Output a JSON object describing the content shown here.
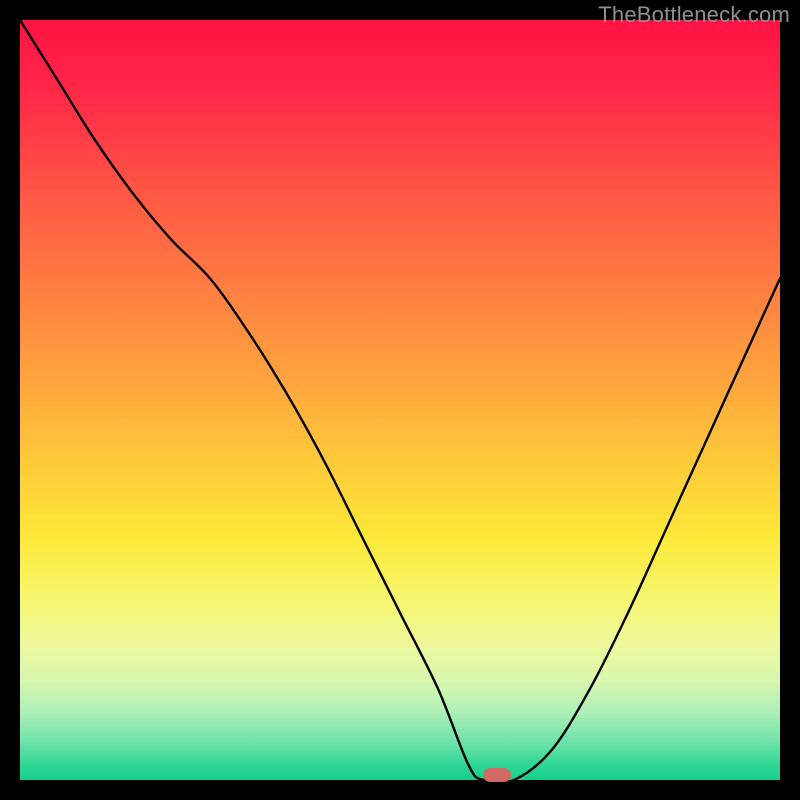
{
  "watermark": "TheBottleneck.com",
  "marker": {
    "x_fraction": 0.628,
    "y_fraction": 0.994
  },
  "chart_data": {
    "type": "line",
    "title": "",
    "xlabel": "",
    "ylabel": "",
    "xlim": [
      0,
      1
    ],
    "ylim": [
      0,
      1
    ],
    "x": [
      0.0,
      0.05,
      0.1,
      0.15,
      0.2,
      0.25,
      0.3,
      0.35,
      0.4,
      0.45,
      0.5,
      0.55,
      0.59,
      0.61,
      0.65,
      0.7,
      0.75,
      0.8,
      0.85,
      0.9,
      0.95,
      1.0
    ],
    "values": [
      1.0,
      0.92,
      0.84,
      0.77,
      0.71,
      0.66,
      0.59,
      0.51,
      0.42,
      0.32,
      0.22,
      0.12,
      0.02,
      0.0,
      0.0,
      0.04,
      0.12,
      0.22,
      0.33,
      0.44,
      0.55,
      0.66
    ],
    "note": "V-shaped curve with minimum near x≈0.63; left descent ~top-left to bottom-center, right ascent to ~y=0.66 at x=1. Axes unlabeled in image; values are normalized estimates from pixels."
  }
}
